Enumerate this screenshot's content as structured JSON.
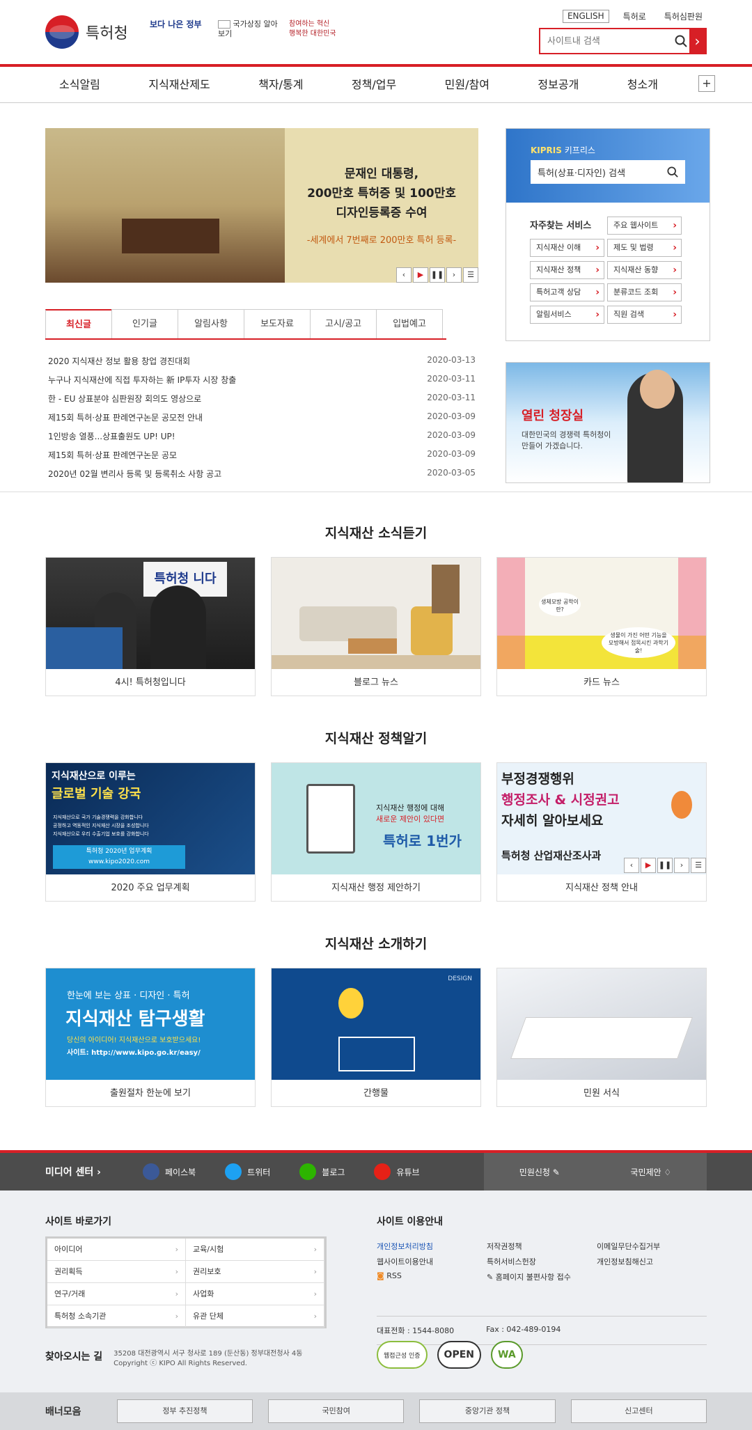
{
  "header": {
    "org_name": "특허청",
    "badge1": "보다 나은 정부",
    "badge2": "국가상징 알아보기",
    "badge3": "참여하는 혁신 행복한 대한민국",
    "util": [
      "ENGLISH",
      "특허로",
      "특허심판원"
    ],
    "search_placeholder": "사이트내 검색"
  },
  "gnb": [
    "소식알림",
    "지식재산제도",
    "책자/통계",
    "정책/업무",
    "민원/참여",
    "정보공개",
    "청소개"
  ],
  "visual": {
    "line1": "문재인 대통령,",
    "line2": "200만호 특허증 및 100만호",
    "line3": "디자인등록증 수여",
    "sub": "-세계에서 7번째로 200만호 특허 등록-",
    "controls": [
      "‹",
      "▶",
      "❚❚",
      "›",
      "☰"
    ]
  },
  "kipris": {
    "label_brand": "KIPRIS",
    "label": "키프리스",
    "search": "특허(상표·디자인) 검색",
    "services_title": "자주찾는 서비스",
    "services": [
      "주요 웹사이트",
      "지식재산 이해",
      "제도 및 법령",
      "지식재산 정책",
      "지식재산 동향",
      "특허고객 상담",
      "분류코드 조회",
      "알림서비스",
      "직원 검색"
    ]
  },
  "tabs": [
    "최신글",
    "인기글",
    "알림사항",
    "보도자료",
    "고시/공고",
    "입법예고"
  ],
  "news": [
    {
      "t": "2020 지식재산 정보 활용 창업 경진대회",
      "d": "2020-03-13"
    },
    {
      "t": "누구나 지식재산에 직접 투자하는 新 IP투자 시장 창출",
      "d": "2020-03-11"
    },
    {
      "t": "한 - EU 상표분야 심판원장 회의도 영상으로",
      "d": "2020-03-11"
    },
    {
      "t": "제15회 특허·상표 판례연구논문 공모전 안내",
      "d": "2020-03-09"
    },
    {
      "t": "1인방송 열풍...상표출원도 UP! UP!",
      "d": "2020-03-09"
    },
    {
      "t": "제15회 특허·상표 판례연구논문 공모",
      "d": "2020-03-09"
    },
    {
      "t": "2020년 02월 변리사 등록 및 등록취소 사항 공고",
      "d": "2020-03-05"
    }
  ],
  "openbox": {
    "title": "열린 청장실",
    "sub": "대한민국의 경쟁력 특허청이 만들어 가겠습니다."
  },
  "sec1": {
    "title": "지식재산 소식듣기",
    "cards": [
      "4시! 특허청입니다",
      "블로그 뉴스",
      "카드 뉴스"
    ],
    "card1_text": "특허청 니다",
    "card3_t1": "생체모방 공학이란?",
    "card3_t2": "생물이 가진 어떤 기능을 모방해서 접목시킨 과학기술!"
  },
  "sec2": {
    "title": "지식재산 정책알기",
    "cards": [
      "2020 주요 업무계획",
      "지식재산 행정 제안하기",
      "지식재산 정책 안내"
    ],
    "c1_t1": "지식재산으로 이루는",
    "c1_t2": "글로벌 기술 강국",
    "c1_bul": [
      "지식재산으로 국가 기술경쟁력을 강화합니다",
      "공정하고 역동적인 지식재산 시장을 조성합니다",
      "지식재산으로 우리 수출기업 보호를 강화합니다"
    ],
    "c1_foot1": "특허청 2020년 업무계획",
    "c1_foot2": "www.kipo2020.com",
    "c2_t1": "지식재산 행정에 대해",
    "c2_t2": "새로운 제안이 있다면",
    "c2_t3": "특허로 1번가",
    "c3_t1": "부정경쟁행위",
    "c3_t2": "행정조사 & 시정권고",
    "c3_t3": "자세히 알아보세요",
    "c3_t4": "특허청 산업재산조사과"
  },
  "sec3": {
    "title": "지식재산 소개하기",
    "cards": [
      "출원절차 한눈에 보기",
      "간행물",
      "민원 서식"
    ],
    "c1_t1": "한눈에 보는 상표 · 디자인 · 특허",
    "c1_t2": "지식재산 탐구생활",
    "c1_t3": "당신의 아이디어! 지식재산으로 보호받으세요!",
    "c1_t4": "사이트: http://www.kipo.go.kr/easy/",
    "c2_tag": "DESIGN"
  },
  "media": {
    "title": "미디어 센터",
    "sns": [
      "페이스북",
      "트위터",
      "블로그",
      "유튜브"
    ],
    "right": [
      "민원신청",
      "국민제안"
    ]
  },
  "footer": {
    "sitego_title": "사이트 바로가기",
    "sitego": [
      "아이디어",
      "교육/시험",
      "권리획득",
      "권리보호",
      "연구/거래",
      "사업화",
      "특허청 소속기관",
      "유관 단체"
    ],
    "guide_title": "사이트 이용안내",
    "guide": [
      "개인정보처리방침",
      "저작권정책",
      "이메일무단수집거부",
      "웹사이트이용안내",
      "특허서비스헌장",
      "개인정보침해신고",
      "RSS",
      "홈페이지 불편사항 접수"
    ],
    "tel": "대표전화 : 1544-8080",
    "fax": "Fax : 042-489-0194",
    "addr_title": "찾아오시는 길",
    "addr": "35208 대전광역시 서구 청사로 189 (둔산동) 정부대전청사 4동",
    "copy": "Copyright ⓒ KIPO All Rights Reserved.",
    "certs": [
      "웹접근성 인증",
      "OPEN",
      "WA"
    ]
  },
  "banner": {
    "title": "배너모음",
    "items": [
      "정부 추진정책",
      "국민참여",
      "중앙기관 정책",
      "신고센터"
    ]
  },
  "colors": {
    "brand": "#d71f26",
    "kipris": "#2f75c9"
  }
}
